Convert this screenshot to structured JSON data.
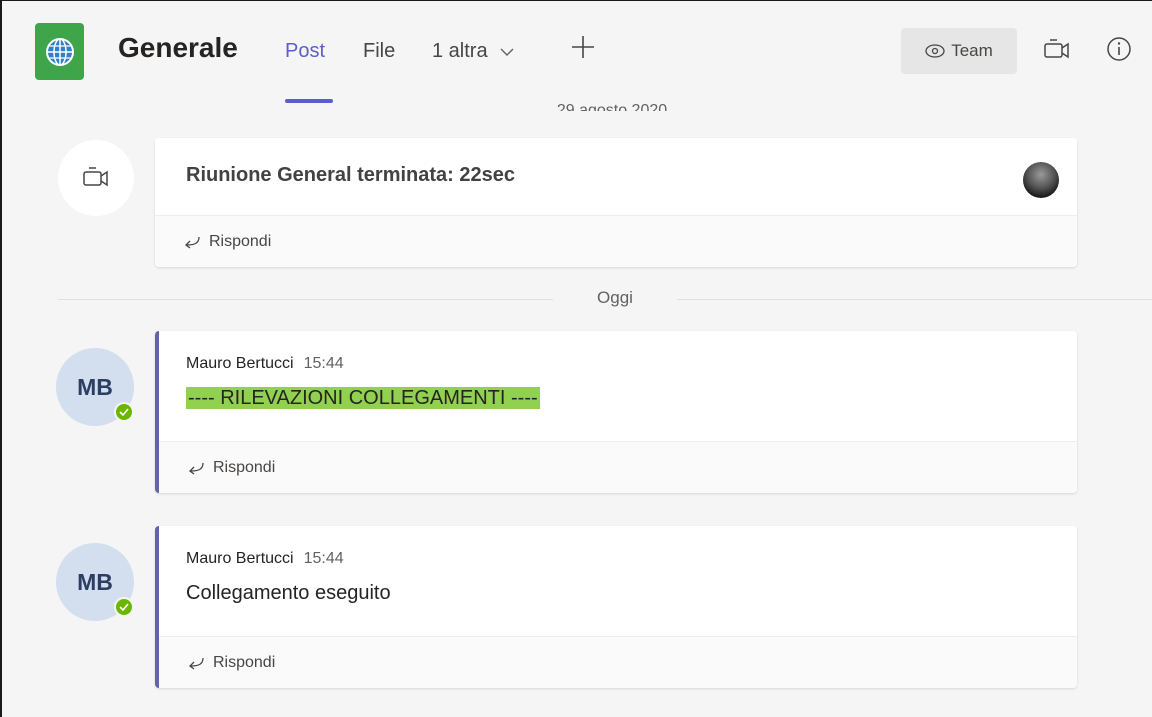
{
  "header": {
    "channel_title": "Generale",
    "tabs": [
      {
        "label": "Post",
        "active": true
      },
      {
        "label": "File",
        "active": false
      },
      {
        "label": "1 altra",
        "active": false
      }
    ],
    "team_button_label": "Team"
  },
  "feed": {
    "partial_date": "29 agosto 2020",
    "meeting": {
      "text": "Riunione General terminata: 22sec",
      "reply_label": "Rispondi"
    },
    "today_label": "Oggi",
    "messages": [
      {
        "initials": "MB",
        "author": "Mauro Bertucci",
        "time": "15:44",
        "text": "----  RILEVAZIONI COLLEGAMENTI  ----",
        "highlight_color": "#92d050",
        "reply_label": "Rispondi"
      },
      {
        "initials": "MB",
        "author": "Mauro Bertucci",
        "time": "15:44",
        "text": "Collegamento eseguito",
        "reply_label": "Rispondi"
      }
    ]
  },
  "colors": {
    "accent": "#5b5fc7",
    "team_logo": "#3fa54a",
    "presence_available": "#6bb700",
    "background": "#f5f5f5"
  },
  "icons": [
    "globe-icon",
    "add-icon",
    "eye-icon",
    "meet-now-icon",
    "info-icon",
    "chevron-down-icon",
    "reply-icon",
    "checkmark-icon"
  ]
}
